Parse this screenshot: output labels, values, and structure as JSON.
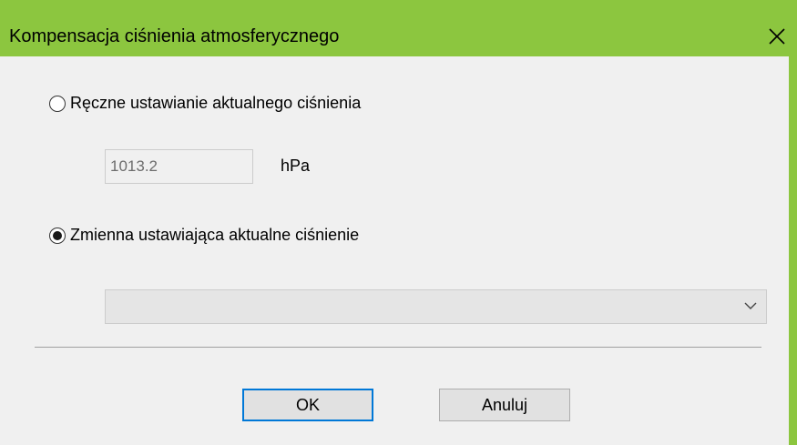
{
  "window": {
    "title": "Kompensacja ciśnienia atmosferycznego",
    "close_icon": "close-icon",
    "accent_color": "#8cc63f"
  },
  "manual": {
    "label": "Ręczne ustawianie aktualnego ciśnienia",
    "selected": false,
    "value": "1013.2",
    "unit": "hPa"
  },
  "variable": {
    "label": "Zmienna ustawiająca aktualne ciśnienie",
    "selected": true,
    "selected_value": "",
    "dropdown_icon": "chevron-down-icon"
  },
  "buttons": {
    "ok_label": "OK",
    "cancel_label": "Anuluj"
  }
}
